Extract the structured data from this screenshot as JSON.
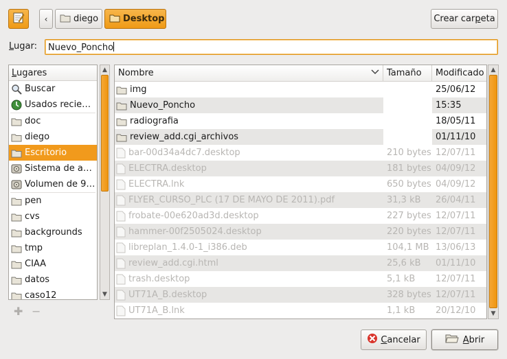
{
  "toolbar": {
    "edit_icon": "pencil-note-icon",
    "back_icon": "chevron-left",
    "path": [
      {
        "label": "diego",
        "active": false
      },
      {
        "label": "Desktop",
        "active": true
      }
    ],
    "create_folder_pre": "Crear car",
    "create_folder_mnemonic": "p",
    "create_folder_post": "eta"
  },
  "location": {
    "label_mnemonic": "L",
    "label_rest": "ugar:",
    "value": "Nuevo_Poncho"
  },
  "places": {
    "header_mnemonic": "L",
    "header_rest": "ugares",
    "items": [
      {
        "label": "Buscar",
        "icon": "search-icon",
        "group": 1
      },
      {
        "label": "Usados recie…",
        "icon": "recent-icon",
        "group": 1
      },
      {
        "label": "doc",
        "icon": "folder-icon",
        "group": 2
      },
      {
        "label": "diego",
        "icon": "folder-icon",
        "group": 2
      },
      {
        "label": "Escritorio",
        "icon": "folder-icon",
        "group": 2,
        "selected": true
      },
      {
        "label": "Sistema de a…",
        "icon": "drive-icon",
        "group": 2
      },
      {
        "label": "Volumen de 9…",
        "icon": "drive-icon",
        "group": 2
      },
      {
        "label": "pen",
        "icon": "folder-icon",
        "group": 3
      },
      {
        "label": "cvs",
        "icon": "folder-icon",
        "group": 3
      },
      {
        "label": "backgrounds",
        "icon": "folder-icon",
        "group": 3
      },
      {
        "label": "tmp",
        "icon": "folder-icon",
        "group": 3
      },
      {
        "label": "CIAA",
        "icon": "folder-icon",
        "group": 3
      },
      {
        "label": "datos",
        "icon": "folder-icon",
        "group": 3
      },
      {
        "label": "caso12",
        "icon": "folder-icon",
        "group": 3
      }
    ]
  },
  "files": {
    "columns": {
      "name": "Nombre",
      "size": "Tamaño",
      "modified": "Modificado"
    },
    "rows": [
      {
        "name": "img",
        "size": "",
        "modified": "25/06/12",
        "kind": "folder"
      },
      {
        "name": "Nuevo_Poncho",
        "size": "",
        "modified": "15:35",
        "kind": "folder"
      },
      {
        "name": "radiografia",
        "size": "",
        "modified": "18/05/11",
        "kind": "folder"
      },
      {
        "name": "review_add.cgi_archivos",
        "size": "",
        "modified": "01/11/10",
        "kind": "folder"
      },
      {
        "name": "bar-00d34a4dc7.desktop",
        "size": "210 bytes",
        "modified": "12/07/11",
        "kind": "file"
      },
      {
        "name": "ELECTRA.desktop",
        "size": "181 bytes",
        "modified": "04/09/12",
        "kind": "file"
      },
      {
        "name": "ELECTRA.lnk",
        "size": "650 bytes",
        "modified": "04/09/12",
        "kind": "file"
      },
      {
        "name": "FLYER_CURSO_PLC (17 DE MAYO DE 2011).pdf",
        "size": "31,3 kB",
        "modified": "26/04/11",
        "kind": "file"
      },
      {
        "name": "frobate-00e620ad3d.desktop",
        "size": "227 bytes",
        "modified": "12/07/11",
        "kind": "file"
      },
      {
        "name": "hammer-00f2505024.desktop",
        "size": "220 bytes",
        "modified": "12/07/11",
        "kind": "file"
      },
      {
        "name": "libreplan_1.4.0-1_i386.deb",
        "size": "104,1 MB",
        "modified": "13/06/13",
        "kind": "file"
      },
      {
        "name": "review_add.cgi.html",
        "size": "25,6 kB",
        "modified": "01/11/10",
        "kind": "file"
      },
      {
        "name": "trash.desktop",
        "size": "5,1 kB",
        "modified": "12/07/11",
        "kind": "file"
      },
      {
        "name": "UT71A_B.desktop",
        "size": "328 bytes",
        "modified": "12/07/11",
        "kind": "file"
      },
      {
        "name": "UT71A_B.lnk",
        "size": "1,1 kB",
        "modified": "20/12/10",
        "kind": "file"
      }
    ]
  },
  "buttons": {
    "cancel_mnemonic": "C",
    "cancel_rest": "ancelar",
    "open_mnemonic": "A",
    "open_rest": "brir"
  },
  "colors": {
    "accent": "#f19a1c",
    "background": "#edeceb",
    "dimmed_text": "#b8b6b3"
  }
}
